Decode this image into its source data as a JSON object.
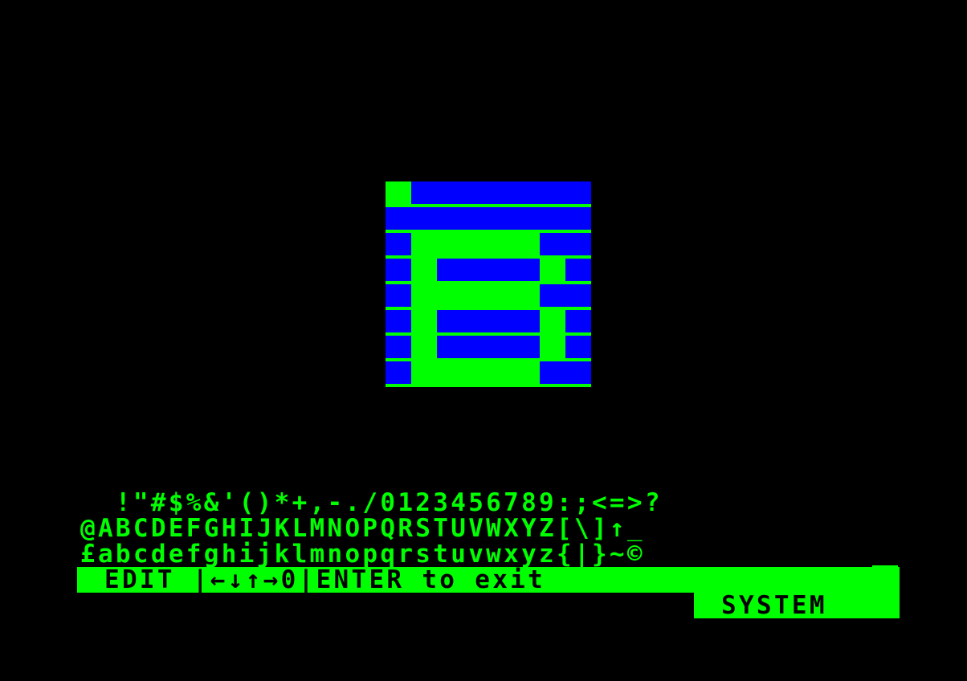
{
  "colors": {
    "background": "#000000",
    "text": "#00ff00",
    "pixel_on": "#00ff00",
    "pixel_off": "#0000ff",
    "bar_background": "#00ff00",
    "bar_text": "#000000"
  },
  "editor": {
    "grid_rows": 8,
    "grid_cols": 8,
    "pixels": [
      "10000000",
      "00000000",
      "01111100",
      "01000010",
      "01111100",
      "01000010",
      "01000010",
      "01111100"
    ]
  },
  "charset": {
    "row1": "  !\"#$%&'()*+,-./0123456789:;<=>?",
    "row2": "@ABCDEFGHIJKLMNOPQRSTUVWXYZ[\\]↑_",
    "row3": "£abcdefghijklmnopqrstuvwxyz{|}~©"
  },
  "status_bar": {
    "label": "EDIT |←↓↑→0|ENTER to exit"
  },
  "mode_badge": {
    "label": "SYSTEM"
  }
}
